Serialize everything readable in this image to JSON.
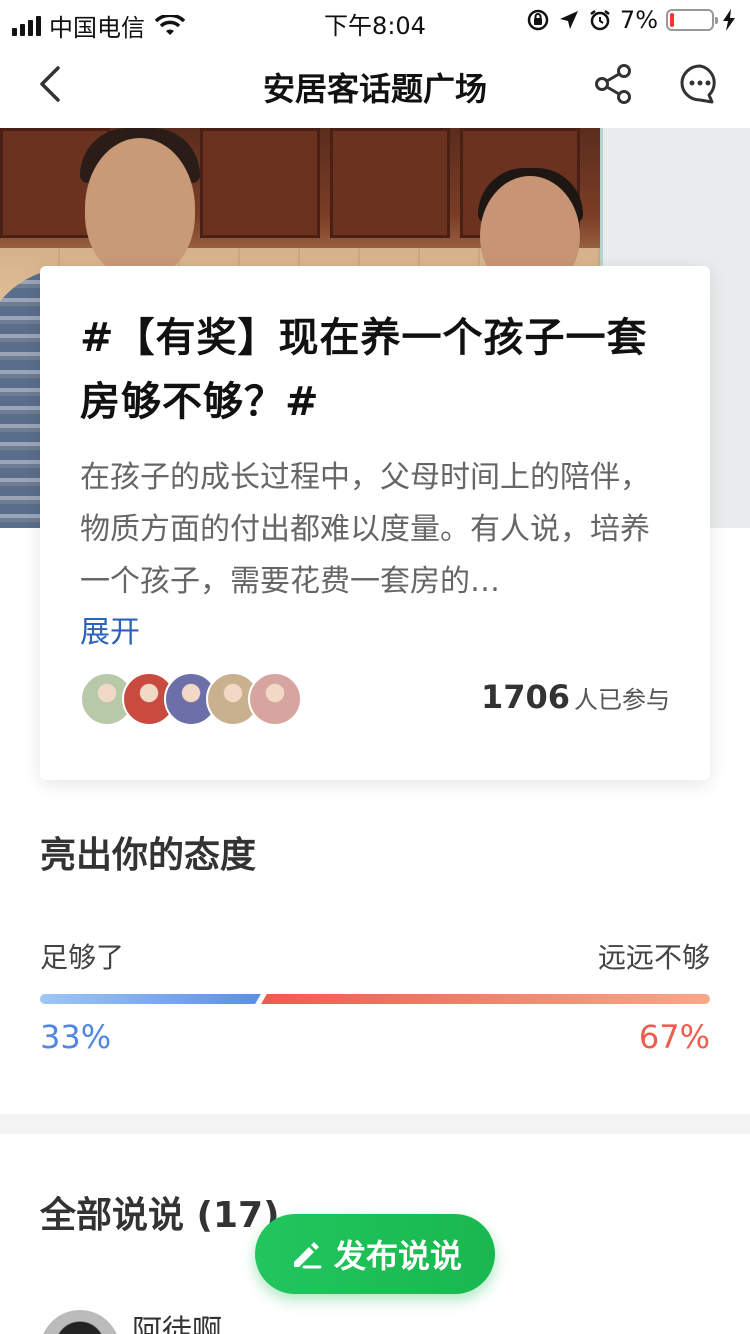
{
  "status_bar": {
    "carrier": "中国电信",
    "time": "下午8:04",
    "battery": "7%",
    "battery_level": 0.07
  },
  "nav": {
    "title": "安居客话题广场"
  },
  "topic": {
    "title": "#【有奖】现在养一个孩子一套房够不够？#",
    "description": "在孩子的成长过程中，父母时间上的陪伴，物质方面的付出都难以度量。有人说，培养一个孩子，需要花费一套房的…",
    "expand_label": "展开",
    "participants_count": "1706",
    "participants_label": "人已参与",
    "avatars": [
      "#b7c9a8",
      "#c94a3f",
      "#6c6fa8",
      "#c9b08f",
      "#d7a5a0"
    ]
  },
  "attitude": {
    "title": "亮出你的态度",
    "left_label": "足够了",
    "right_label": "远远不够",
    "left_percent_text": "33%",
    "right_percent_text": "67%",
    "left_percent": 33,
    "right_percent": 67
  },
  "comments": {
    "title": "全部说说 (17)",
    "first_user_name": "阿徒啊"
  },
  "post_button": {
    "label": "发布说说"
  }
}
